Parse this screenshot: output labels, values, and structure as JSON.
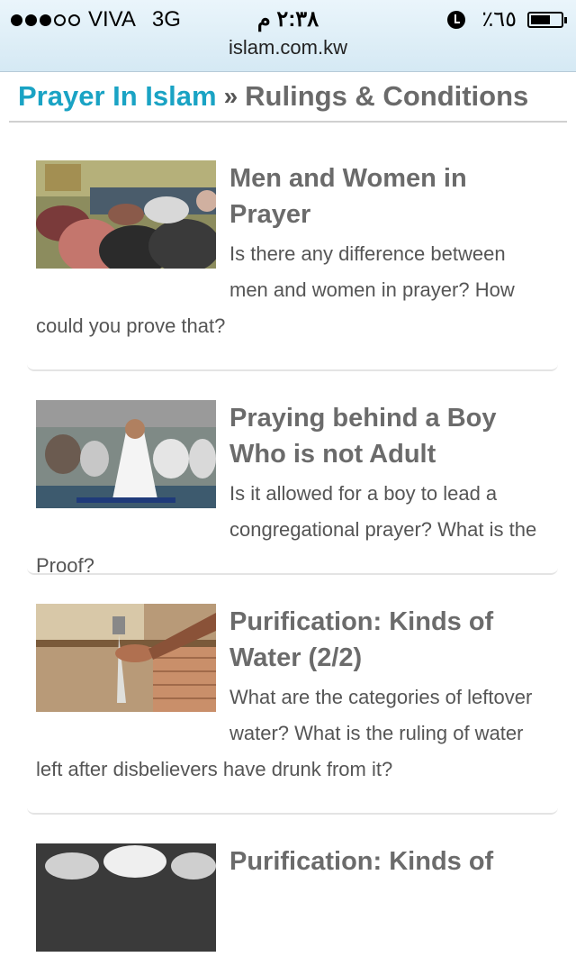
{
  "status_bar": {
    "carrier": "VIVA",
    "network": "3G",
    "time": "٢:٣٨ م",
    "battery_text": "٪٦٥",
    "battery_level": 0.65,
    "signal_strength": 3,
    "signal_max": 5,
    "icons": [
      "alarm-icon",
      "battery-icon"
    ]
  },
  "browser": {
    "url": "islam.com.kw"
  },
  "breadcrumb": {
    "parent": "Prayer In Islam",
    "separator": "»",
    "current": "Rulings & Conditions"
  },
  "colors": {
    "link": "#1aa3c4",
    "title": "#6b6b6b",
    "text": "#555555"
  },
  "articles": [
    {
      "title": "Men and Women in Prayer",
      "description": "Is there any difference between men and women in prayer? How could you prove that?"
    },
    {
      "title": "Praying behind a Boy Who is not Adult",
      "description": "Is it allowed for a boy to lead a congregational prayer? What is the Proof?"
    },
    {
      "title": "Purification: Kinds of Water (2/2)",
      "description": "What are the categories of leftover water? What is the ruling of water left after disbelievers have drunk from it?"
    },
    {
      "title": "Purification: Kinds of",
      "description": ""
    }
  ]
}
